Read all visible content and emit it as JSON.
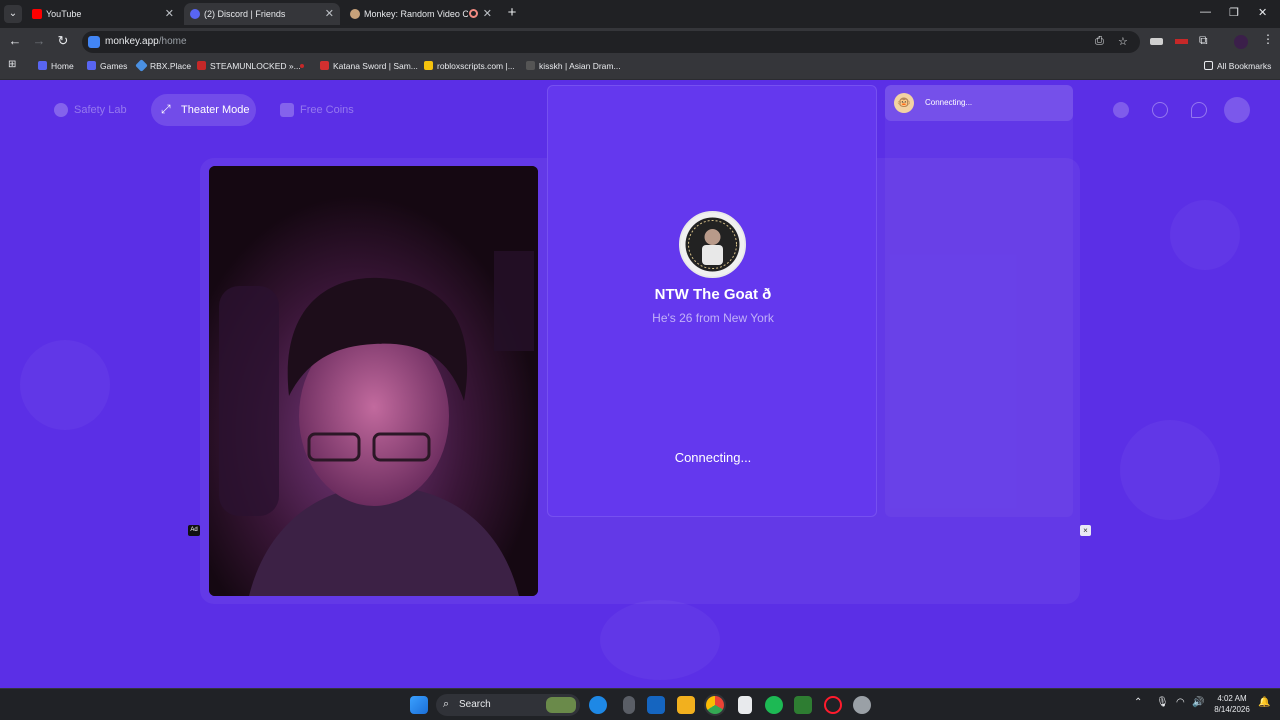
{
  "browser": {
    "tabs": [
      {
        "title": "YouTube",
        "active": false,
        "favicon_color": "#ff0000"
      },
      {
        "title": "(2) Discord | Friends",
        "active": true,
        "favicon_color": "#5865f2"
      },
      {
        "title": "Monkey: Random Video Ch",
        "active": false,
        "favicon_color": "#c8a27a"
      }
    ],
    "address": {
      "host": "monkey.app",
      "path": "/home"
    },
    "bookmarks": [
      {
        "label": "Home",
        "color": "#5865f2"
      },
      {
        "label": "Games",
        "color": "#5865f2"
      },
      {
        "label": "RBX.Place",
        "color": "#4a90e2"
      },
      {
        "label": "STEAMUNLOCKED »...",
        "color": "#c62828"
      },
      {
        "label": "",
        "color": "#c62828"
      },
      {
        "label": "Katana Sword | Sam...",
        "color": "#d32f2f"
      },
      {
        "label": "robloxscripts.com |...",
        "color": "#f4c20d"
      },
      {
        "label": "kisskh | Asian Dram...",
        "color": "#555555"
      }
    ],
    "all_bookmarks": "All Bookmarks"
  },
  "app": {
    "nav": {
      "safety_lab": "Safety Lab",
      "theater_mode": "Theater Mode",
      "free_coins": "Free Coins"
    },
    "peer": {
      "name": "NTW The Goat ð",
      "subtitle": "He's 26 from New York",
      "status": "Connecting..."
    },
    "chat": {
      "status": "Connecting..."
    },
    "ad_badge": "Ad",
    "ad_close": "×",
    "colors": {
      "background": "#5b2fe6",
      "panel": "#6438ee"
    }
  },
  "taskbar": {
    "search_label": "Search",
    "time": "4:02 AM",
    "date": "8/14/2026"
  }
}
